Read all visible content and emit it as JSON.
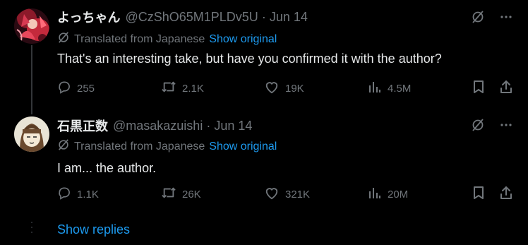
{
  "tweets": [
    {
      "display_name": "よっちゃん",
      "handle": "@CzShO65M1PLDv5U",
      "separator": "·",
      "date": "Jun 14",
      "translated_label": "Translated from Japanese",
      "show_original": "Show original",
      "text": "That's an interesting take, but have you confirmed it with the author?",
      "replies": "255",
      "retweets": "2.1K",
      "likes": "19K",
      "views": "4.5M"
    },
    {
      "display_name": "石黒正数",
      "handle": "@masakazuishi",
      "separator": "·",
      "date": "Jun 14",
      "translated_label": "Translated from Japanese",
      "show_original": "Show original",
      "text": "I am... the author.",
      "replies": "1.1K",
      "retweets": "26K",
      "likes": "321K",
      "views": "20M"
    }
  ],
  "show_replies": "Show replies",
  "colors": {
    "background": "#000000",
    "text": "#e7e9ea",
    "secondary": "#71767b",
    "link": "#1d9bf0",
    "thread_line": "#333639"
  },
  "icons": [
    "grok-icon",
    "more-icon",
    "translate-icon",
    "reply-icon",
    "retweet-icon",
    "like-icon",
    "views-icon",
    "bookmark-icon",
    "share-icon"
  ]
}
